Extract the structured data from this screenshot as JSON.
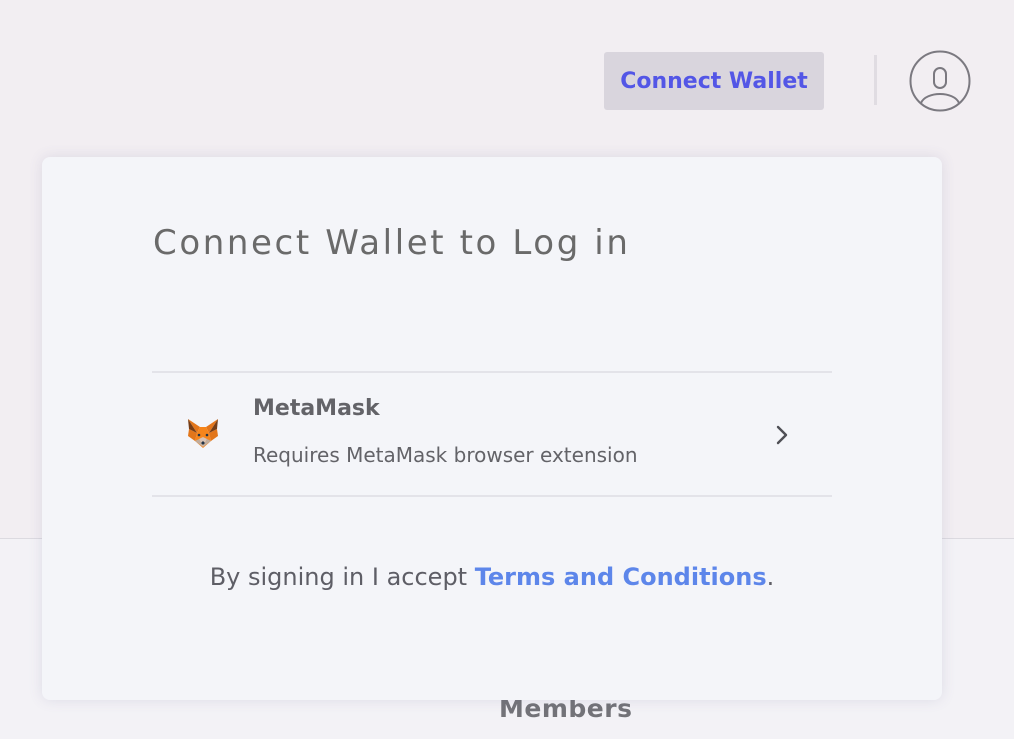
{
  "header": {
    "connect_wallet_label": "Connect Wallet",
    "profile_icon": "user-circle-icon"
  },
  "modal": {
    "title": "Connect Wallet to Log in",
    "wallets": [
      {
        "name": "MetaMask",
        "description": "Requires MetaMask browser extension",
        "icon": "metamask-fox-icon"
      }
    ],
    "terms_prefix": "By signing in I accept ",
    "terms_link": "Terms and Conditions",
    "terms_suffix": "."
  },
  "background": {
    "section_label": "Members"
  },
  "colors": {
    "accent": "#5356e6",
    "link": "#5d86ea",
    "button_bg": "#d9d5dd",
    "page_bg": "#f2eef2",
    "modal_bg": "#f4f5f9"
  }
}
